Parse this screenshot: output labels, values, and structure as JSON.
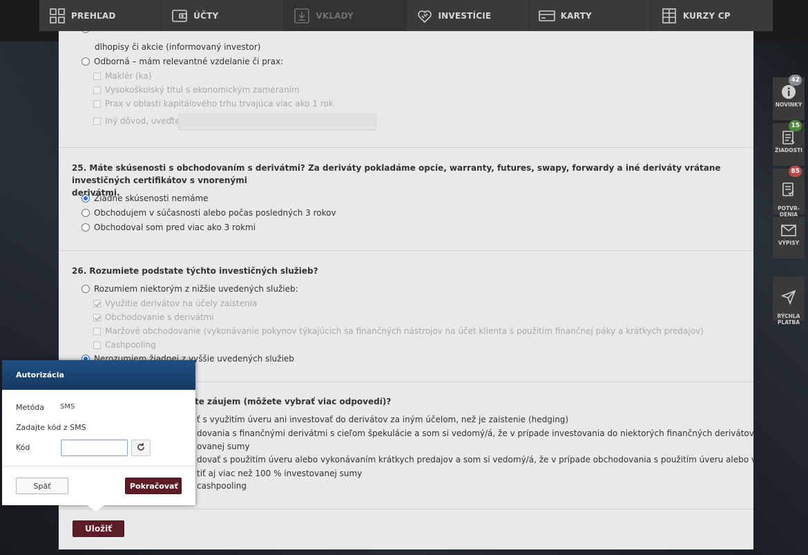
{
  "nav": [
    {
      "label": "PREHĽAD",
      "icon": "grid-icon"
    },
    {
      "label": "ÚČTY",
      "icon": "wallet-icon"
    },
    {
      "label": "VKLADY",
      "icon": "deposit-icon"
    },
    {
      "label": "INVESTÍCIE",
      "icon": "handshake-icon"
    },
    {
      "label": "KARTY",
      "icon": "card-icon"
    },
    {
      "label": "KURZY CP",
      "icon": "table-icon"
    }
  ],
  "q24": {
    "cut_line": "dlhopisy či akcie (informovaný investor)",
    "opt_expert": "Odborná – mám relevantné vzdelanie či prax:",
    "sub": [
      "Maklér (ka)",
      "Vysokoškolský titul s ekonomickým zameraním",
      "Prax v oblasti kapitálového trhu trvajúca viac ako 1 rok"
    ],
    "other_label": "Iný dôvod, uveďte:"
  },
  "q25": {
    "title_line1": "25. Máte skúsenosti s obchodovaním s derivátmi? Za deriváty pokladáme opcie, warranty, futures, swapy, forwardy a iné deriváty vrátane investičných certifikátov s vnorenými",
    "title_line2": "derivátmi.",
    "options": [
      "Žiadne skúsenosti nemáme",
      "Obchodujem v súčasnosti alebo počas posledných 3 rokov",
      "Obchodoval som pred viac ako 3 rokmi"
    ]
  },
  "q26": {
    "title": "26. Rozumiete podstate týchto investičných služieb?",
    "opt_understand": "Rozumiem niektorým z nižšie uvedených služieb:",
    "sub": [
      "Využitie derivátov na účely zaistenia",
      "Obchodovanie s derivátmi",
      "Maržové obchodovanie (vykonávanie pokynov týkajúcich sa finančných nástrojov na účet klienta s použitím finančnej páky a krátkych predajov)",
      "Cashpooling"
    ],
    "opt_none": "Nerozumiem žiadnej z vyššie uvedených služieb"
  },
  "q27": {
    "title_tail": "te záujem (môžete vybrať viac odpovedí)?",
    "lines": [
      "ť s využitím úveru ani investovať do derivátov za iným účelom, než je zaistenie (hedging)",
      "dovania s finančnými derivátmi s cieľom špekulácie a som si vedomý/á, že v prípade investovania do niektorých finančných derivátov môžem",
      "ovanej sumy",
      "dovať s použitím úveru alebo vykonávaním krátkych predajov a som si vedomý/á, že v prípade obchodovania s použitím úveru alebo vykonávaním",
      "tiť aj viac než 100 % investovanej sumy",
      "cashpooling"
    ]
  },
  "save_label": "Uložiť",
  "sidebar": [
    {
      "label": "NOVINKY",
      "badge": "42",
      "badge_color": "#8a8f96",
      "icon": "info-icon"
    },
    {
      "label": "ŽIADOSTI",
      "badge": "15",
      "badge_color": "#4f8a3c",
      "icon": "document-icon"
    },
    {
      "label": "POTVR-\nDENIA",
      "badge": "85",
      "badge_color": "#b84a4a",
      "icon": "confirm-icon"
    },
    {
      "label": "VÝPISY",
      "badge": "",
      "badge_color": "",
      "icon": "mail-icon"
    },
    {
      "label": "RÝCHLA\nPLATBA",
      "badge": "",
      "badge_color": "",
      "icon": "send-icon"
    }
  ],
  "modal": {
    "title": "Autorizácia",
    "method_label": "Metóda",
    "method_value": "SMS",
    "prompt": "Zadajte kód z SMS",
    "code_label": "Kód",
    "code_value": "",
    "back_label": "Späť",
    "continue_label": "Pokračovať"
  }
}
